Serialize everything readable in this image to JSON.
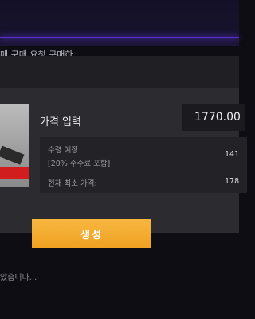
{
  "background": {
    "top_text": "매 구매 요청 구매하"
  },
  "dialog": {
    "price_label": "가격 입력",
    "price_value": "1770.00",
    "info": {
      "fee_label": "수령 예정",
      "fee_sub": "[20% 수수료 포함]",
      "fee_value": "141",
      "min_price_label": "현재 최소 가격:",
      "min_price_value": "178"
    },
    "create_button": "생성"
  },
  "bottom_text": "았습니다...",
  "colors": {
    "accent_purple": "#5a2fd6",
    "button_orange": "#f0a223",
    "item_red": "#d11d1d"
  }
}
